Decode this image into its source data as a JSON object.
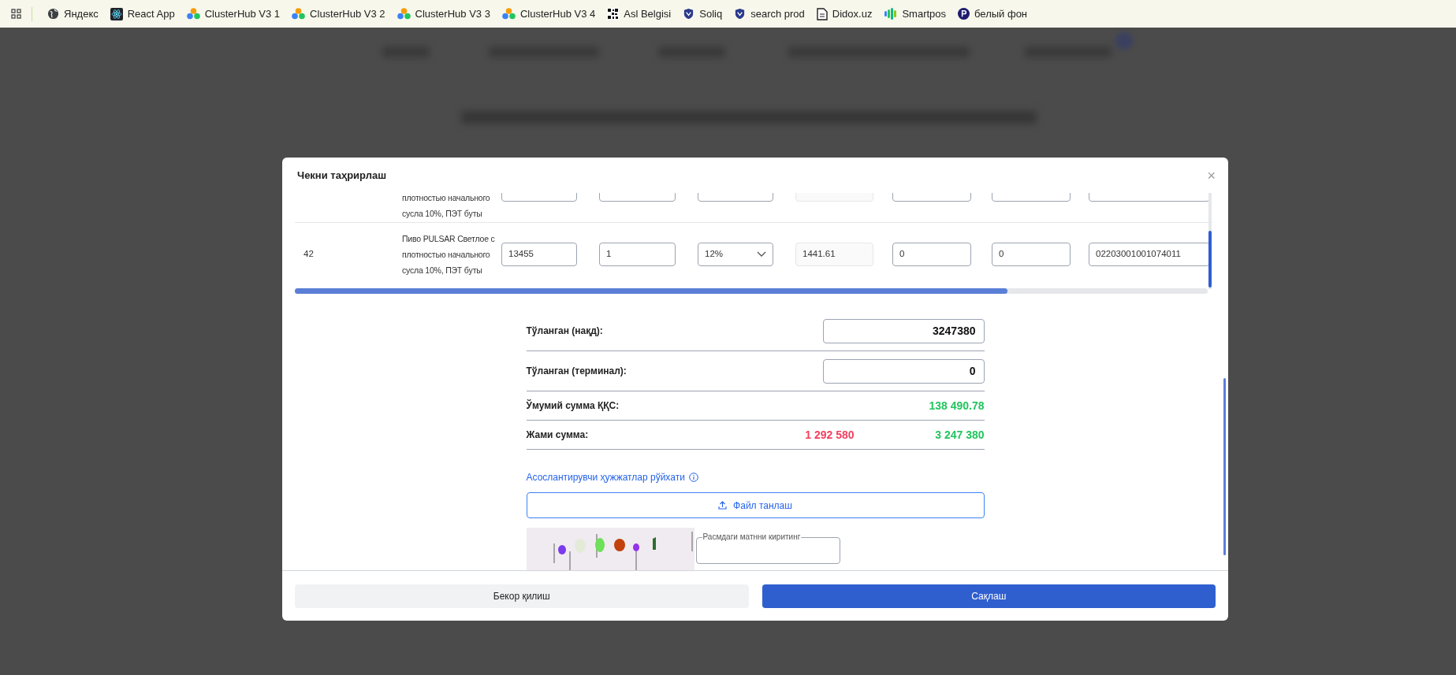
{
  "bookmarks": [
    {
      "label": "Яндекс",
      "kind": "globe"
    },
    {
      "label": "React App",
      "kind": "atom"
    },
    {
      "label": "ClusterHub V3 1",
      "kind": "cluster"
    },
    {
      "label": "ClusterHub V3 2",
      "kind": "cluster"
    },
    {
      "label": "ClusterHub V3 3",
      "kind": "cluster"
    },
    {
      "label": "ClusterHub V3 4",
      "kind": "cluster"
    },
    {
      "label": "Asl Belgisi",
      "kind": "grid"
    },
    {
      "label": "Soliq",
      "kind": "shield"
    },
    {
      "label": "search prod",
      "kind": "shield"
    },
    {
      "label": "Didox.uz",
      "kind": "document"
    },
    {
      "label": "Smartpos",
      "kind": "fan"
    },
    {
      "label": "белый фон",
      "kind": "badge"
    }
  ],
  "modal": {
    "title": "Чекни таҳрирлаш",
    "close": "×",
    "rows": [
      {
        "kind": "partial",
        "name": "плотностью начального сусла 10%, ПЭТ бyты",
        "cells": [
          {
            "kind": "input"
          },
          {
            "kind": "input"
          },
          {
            "kind": "select"
          },
          {
            "kind": "readonly"
          },
          {
            "kind": "input"
          },
          {
            "kind": "input"
          },
          {
            "kind": "input"
          }
        ]
      },
      {
        "kind": "full",
        "number": "42",
        "name": "Пиво PULSAR Светлое с плотностью начального сусла 10%, ПЭТ бyты",
        "cells": [
          {
            "kind": "input",
            "value": "13455"
          },
          {
            "kind": "input",
            "value": "1"
          },
          {
            "kind": "select",
            "value": "12%"
          },
          {
            "kind": "readonly",
            "value": "1441.61"
          },
          {
            "kind": "input",
            "value": "0"
          },
          {
            "kind": "input",
            "value": "0"
          },
          {
            "kind": "input",
            "value": "02203001001074011"
          }
        ]
      }
    ],
    "totals": [
      {
        "kind": "input",
        "label": "Тўланган (нақд):",
        "value": "3247380"
      },
      {
        "kind": "input",
        "label": "Тўланган (терминал):",
        "value": "0"
      },
      {
        "kind": "values",
        "label": "Ўмумий сумма ҚҚС:",
        "values": [
          {
            "text": "138 490.78",
            "color": "#22c55e"
          }
        ]
      },
      {
        "kind": "values",
        "label": "Жами сумма:",
        "values": [
          {
            "text": "1 292 580",
            "color": "#f43f5e"
          },
          {
            "text": "3 247 380",
            "color": "#22c55e"
          }
        ]
      }
    ],
    "documents_link": "Асослантирувчи ҳужжатлар рўйхати",
    "file_button": "Файл танлаш",
    "captcha": {
      "kind": "picture",
      "placeholder": "Расмдаги матнни киритинг"
    },
    "cancel_button": "Бекор қилиш",
    "save_button": "Сақлаш"
  }
}
